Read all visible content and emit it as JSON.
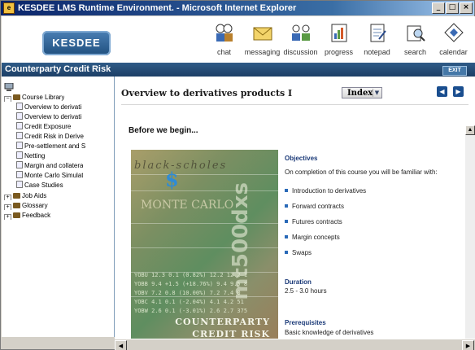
{
  "window": {
    "title": "KESDEE LMS Runtime Environment. - Microsoft Internet Explorer"
  },
  "header": {
    "logo_text": "KESDEE",
    "nav": [
      {
        "label": "chat",
        "icon": "chat-icon"
      },
      {
        "label": "messaging",
        "icon": "envelope-icon"
      },
      {
        "label": "discussion",
        "icon": "discussion-icon"
      },
      {
        "label": "progress",
        "icon": "progress-icon"
      },
      {
        "label": "notepad",
        "icon": "notepad-icon"
      },
      {
        "label": "search",
        "icon": "search-icon"
      },
      {
        "label": "calendar",
        "icon": "calendar-icon"
      }
    ]
  },
  "course": {
    "title": "Counterparty Credit Risk",
    "exit_label": "EXIT"
  },
  "tree": {
    "root": "Course Library",
    "items": [
      "Overview to derivati",
      "Overview to derivati",
      "Credit Exposure",
      "Credit Risk in Derive",
      "Pre-settlement and S",
      "Netting",
      "Margin and collatera",
      "Monte Carlo Simulat",
      "Case Studies"
    ],
    "folders": [
      "Job Aids",
      "Glossary",
      "Feedback"
    ]
  },
  "main": {
    "title": "Overview to derivatives products I",
    "index_label": "Index",
    "before_heading": "Before we begin...",
    "art_text": {
      "black_scholes": "black-scholes",
      "monte_carlo": "MONTE CARLO",
      "vertical": "mt500dxs",
      "line1": "COUNTERPARTY",
      "line2": "CREDIT RISK",
      "tickers": [
        "YOBU 12.3  0.1  (0.82%) 12.2 12.2  1",
        "YOBB  9.4 +1.5 (+18.76%)  9.4  9.5  8",
        "YOBV  7.2  0.8 (10.00%)  7.2  7.4  0",
        "YOBC  4.1  0.1  (-2.04%)  4.1  4.2 51",
        "YOBW  2.6  0.1  (-3.01%)  2.6  2.7 375"
      ]
    },
    "objectives": {
      "heading": "Objectives",
      "intro": "On completion of this course you will be familiar with:",
      "items": [
        "Introduction to derivatives",
        "Forward contracts",
        "Futures contracts",
        "Margin concepts",
        "Swaps"
      ]
    },
    "duration": {
      "heading": "Duration",
      "value": "2.5 - 3.0 hours"
    },
    "prerequisites": {
      "heading": "Prerequisites",
      "value": "Basic knowledge of derivatives"
    }
  }
}
